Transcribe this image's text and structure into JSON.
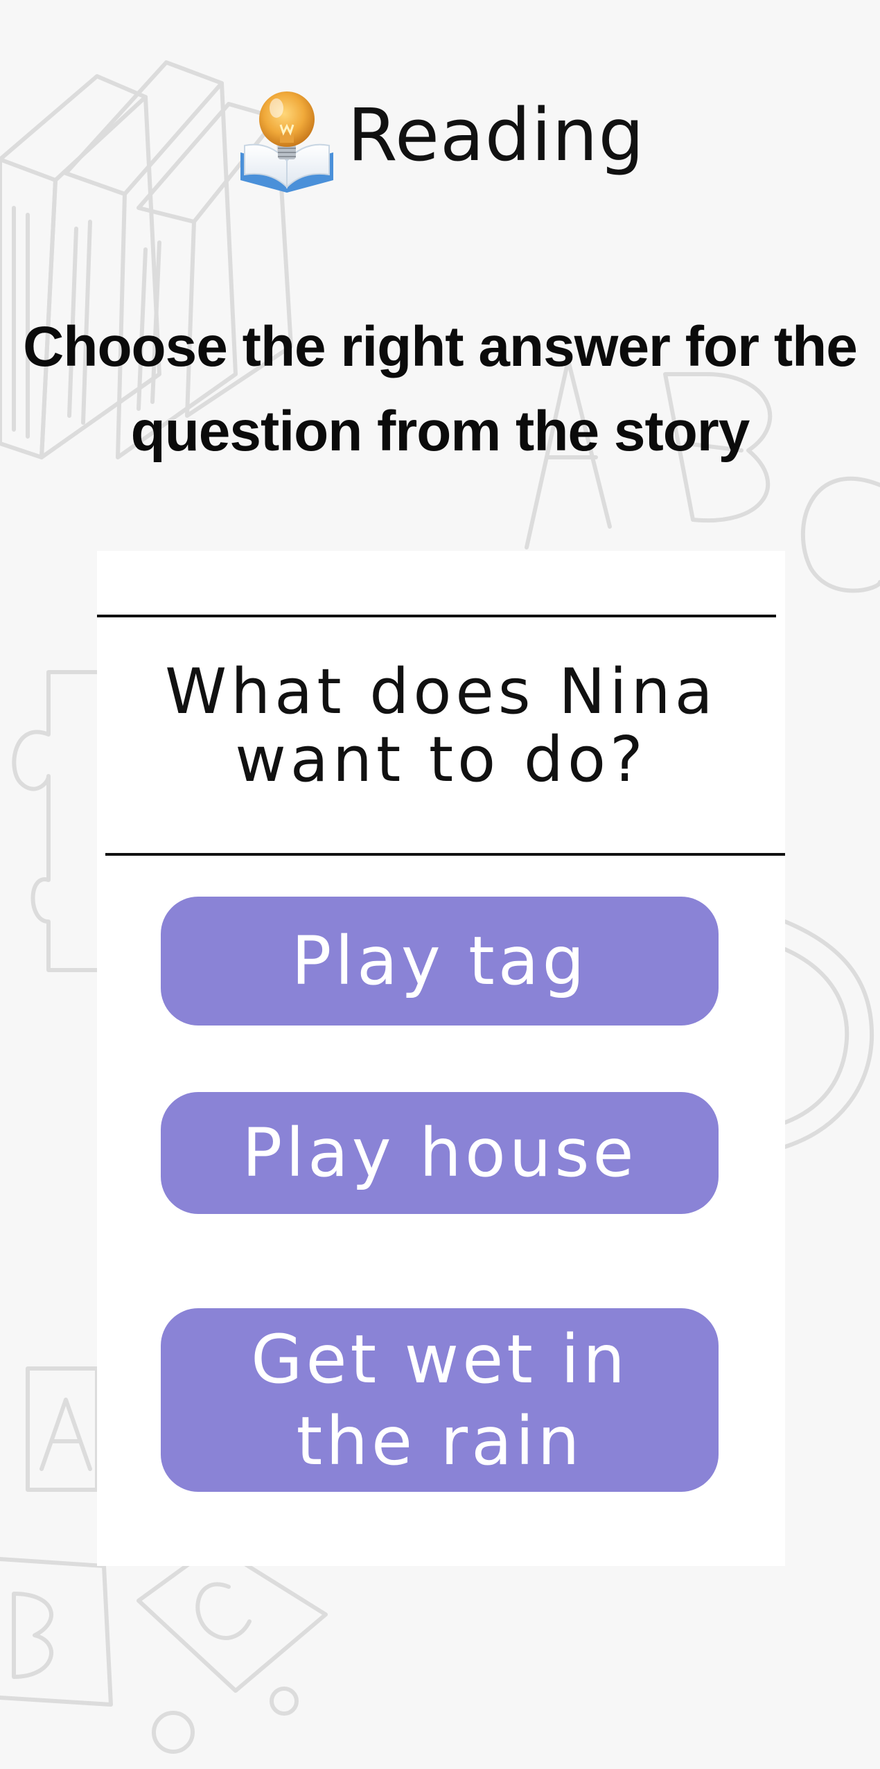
{
  "header": {
    "title": "Reading",
    "icon": "lightbulb-book-icon"
  },
  "instruction": "Choose the right answer for the question from the story",
  "question": "What does Nina want to do?",
  "answers": [
    {
      "label": "Play tag"
    },
    {
      "label": "Play house"
    },
    {
      "label": "Get wet in the rain"
    }
  ],
  "colors": {
    "background": "#f7f7f7",
    "card": "#ffffff",
    "answer_button": "#8a83d6",
    "answer_text": "#ffffff",
    "text": "#111111",
    "doodle": "#dddddd"
  }
}
